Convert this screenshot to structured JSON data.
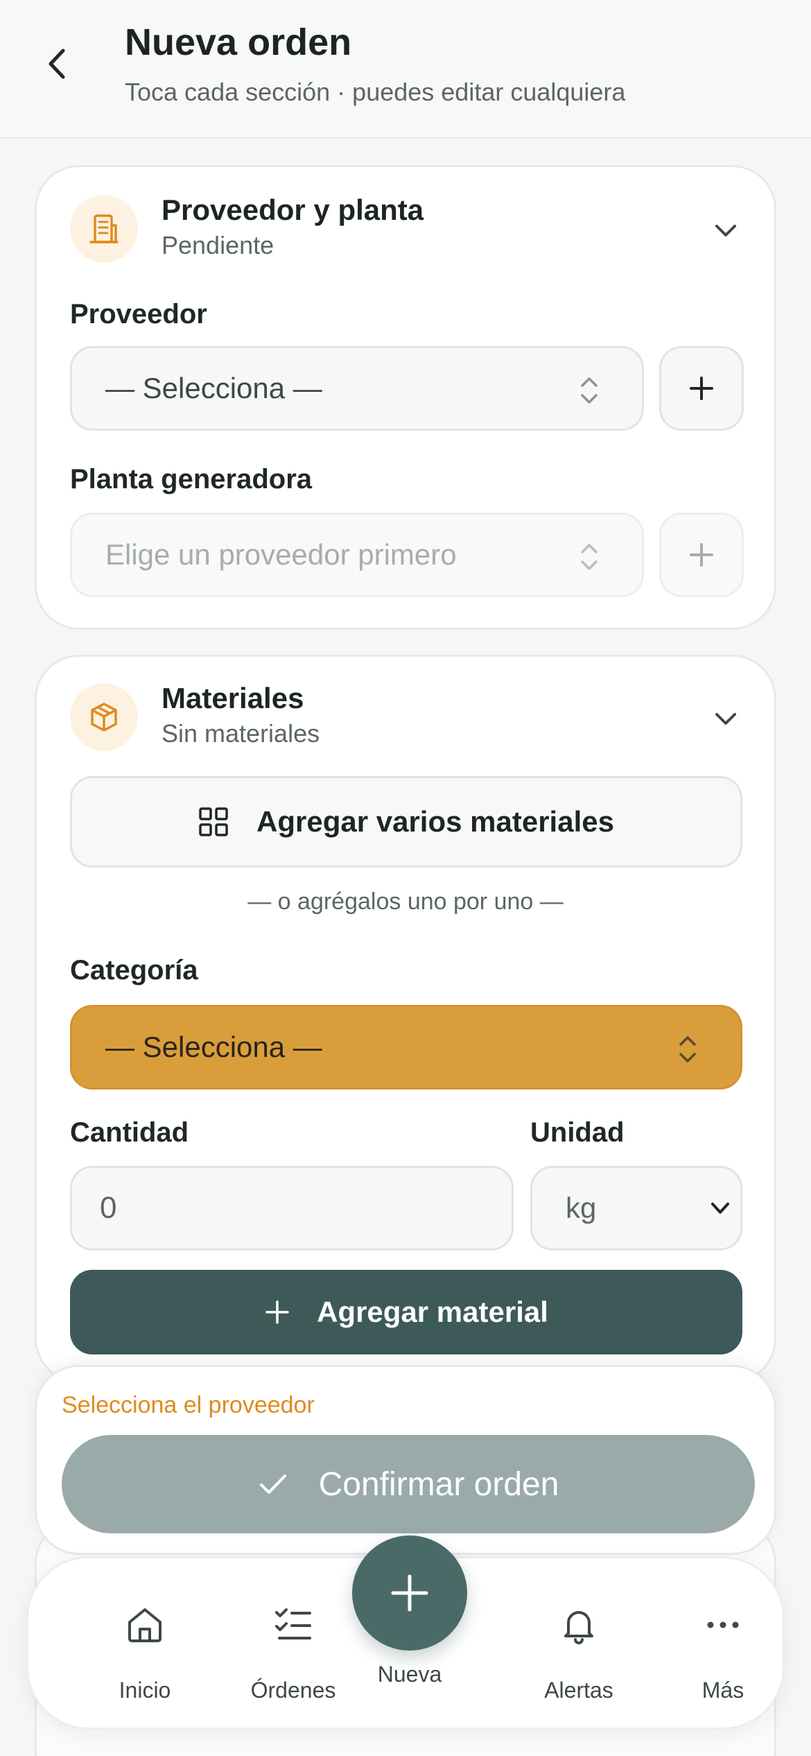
{
  "header": {
    "title": "Nueva orden",
    "subtitle": "Toca cada sección · puedes editar cualquiera"
  },
  "supplier_card": {
    "title": "Proveedor y planta",
    "status": "Pendiente",
    "supplier_label": "Proveedor",
    "supplier_value": "— Selecciona —",
    "plant_label": "Planta generadora",
    "plant_placeholder": "Elige un proveedor primero"
  },
  "materials_card": {
    "title": "Materiales",
    "status": "Sin materiales",
    "multi_button": "Agregar varios materiales",
    "or_text": "— o agrégalos uno por uno —",
    "category_label": "Categoría",
    "category_value": "— Selecciona —",
    "quantity_label": "Cantidad",
    "quantity_value": "0",
    "unit_label": "Unidad",
    "unit_value": "kg",
    "add_button": "Agregar material"
  },
  "confirm": {
    "warning": "Selecciona el proveedor",
    "button": "Confirmar orden"
  },
  "nav": {
    "items": [
      {
        "label": "Inicio",
        "icon": "home-icon"
      },
      {
        "label": "Órdenes",
        "icon": "checklist-icon"
      },
      {
        "label": "Nueva",
        "icon": "plus-icon"
      },
      {
        "label": "Alertas",
        "icon": "bell-icon"
      },
      {
        "label": "Más",
        "icon": "more-icon"
      }
    ]
  },
  "colors": {
    "accent_orange": "#e08a1e",
    "category_fill": "#d99e3b",
    "primary_dark": "#3d5a59",
    "disabled_button": "#9aaaa9"
  }
}
